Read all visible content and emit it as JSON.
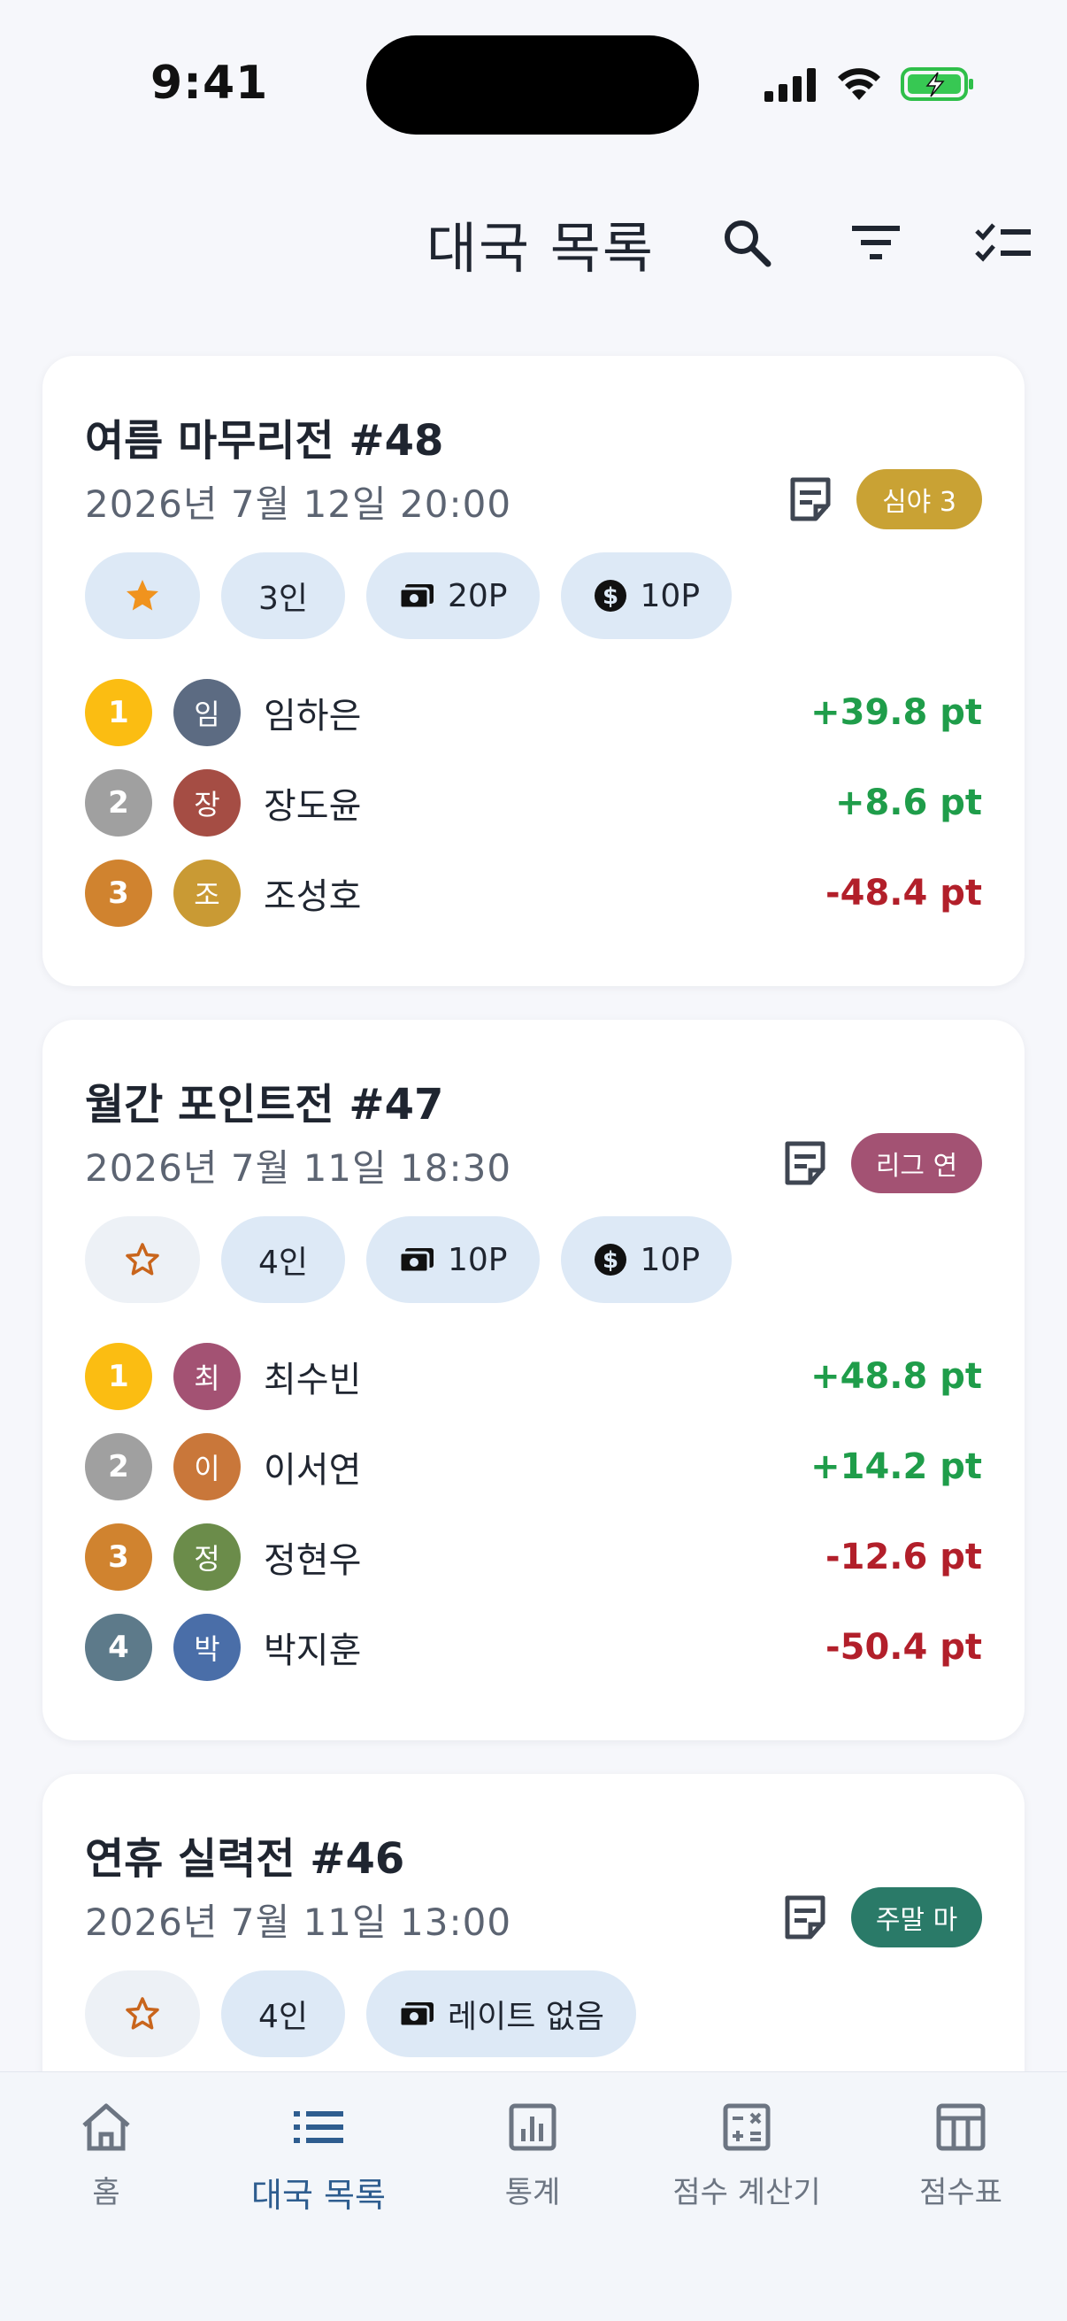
{
  "status_bar": {
    "time": "9:41"
  },
  "header": {
    "title": "대국 목록"
  },
  "games": [
    {
      "title": "여름 마무리전 #48",
      "date": "2026년 7월 12일 20:00",
      "tag": "심야 3",
      "tag_color": "#c9a234",
      "starred": true,
      "players_count": "3인",
      "rate": "20P",
      "chip_rate": "10P",
      "players": [
        {
          "rank": "1",
          "avatar": "임",
          "name": "임하은",
          "score": "+39.8 pt"
        },
        {
          "rank": "2",
          "avatar": "장",
          "name": "장도윤",
          "score": "+8.6 pt"
        },
        {
          "rank": "3",
          "avatar": "조",
          "name": "조성호",
          "score": "-48.4 pt"
        }
      ]
    },
    {
      "title": "월간 포인트전 #47",
      "date": "2026년 7월 11일 18:30",
      "tag": "리그 연",
      "tag_color": "#a35273",
      "starred": false,
      "players_count": "4인",
      "rate": "10P",
      "chip_rate": "10P",
      "players": [
        {
          "rank": "1",
          "avatar": "최",
          "name": "최수빈",
          "score": "+48.8 pt"
        },
        {
          "rank": "2",
          "avatar": "이",
          "name": "이서연",
          "score": "+14.2 pt"
        },
        {
          "rank": "3",
          "avatar": "정",
          "name": "정현우",
          "score": "-12.6 pt"
        },
        {
          "rank": "4",
          "avatar": "박",
          "name": "박지훈",
          "score": "-50.4 pt"
        }
      ]
    },
    {
      "title": "연휴 실력전 #46",
      "date": "2026년 7월 11일 13:00",
      "tag": "주말 마",
      "tag_color": "#2a7a68",
      "starred": false,
      "players_count": "4인",
      "rate": "레이트 없음"
    }
  ],
  "colors": {
    "rank_1": "#fbbd12",
    "rank_2": "#a0a0a0",
    "rank_3": "#d0832f",
    "rank_4": "#5d7a8a",
    "positive": "#1f9d4a",
    "negative": "#b21f2a",
    "accent": "#2e5d8f"
  },
  "nav": {
    "items": [
      {
        "label": "홈",
        "icon": "home-icon"
      },
      {
        "label": "대국 목록",
        "icon": "list-icon",
        "active": true
      },
      {
        "label": "통계",
        "icon": "stats-icon"
      },
      {
        "label": "점수 계산기",
        "icon": "calculator-icon"
      },
      {
        "label": "점수표",
        "icon": "table-icon"
      }
    ]
  }
}
